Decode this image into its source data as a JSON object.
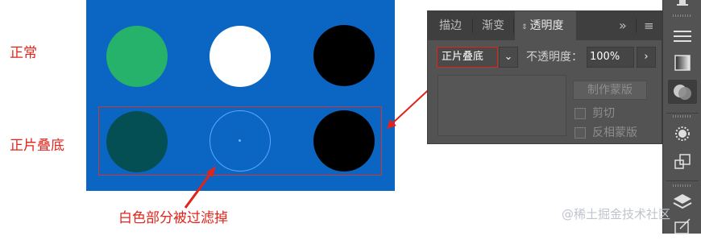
{
  "labels": {
    "normal": "正常",
    "multiply": "正片叠底",
    "annotation": "白色部分被过滤掉"
  },
  "panel": {
    "tabs": [
      {
        "label": "描边"
      },
      {
        "label": "渐变"
      },
      {
        "label": "透明度",
        "active": true
      }
    ],
    "tab_menu_glyph": "»",
    "tab_more_glyph": "≡",
    "blend_mode": "正片叠底",
    "opacity_label": "不透明度：",
    "opacity_value": "100%",
    "make_mask_button": "制作蒙版",
    "clip_label": "剪切",
    "invert_mask_label": "反相蒙版"
  },
  "artboard": {
    "background": "#0b66c3",
    "top_row_colors": [
      "#27b26b",
      "#ffffff",
      "#000000"
    ],
    "bottom_row_colors": [
      "#034f54",
      "transparent",
      "#000000"
    ]
  },
  "colors": {
    "label_red": "#e2231a",
    "panel_bg": "#535353"
  },
  "toolbar_icons": [
    "align-icon",
    "gradient-icon",
    "transparency-icon",
    "appearance-icon",
    "transform-icon",
    "layers-icon",
    "export-icon"
  ],
  "watermark": "@稀土掘金技术社区"
}
